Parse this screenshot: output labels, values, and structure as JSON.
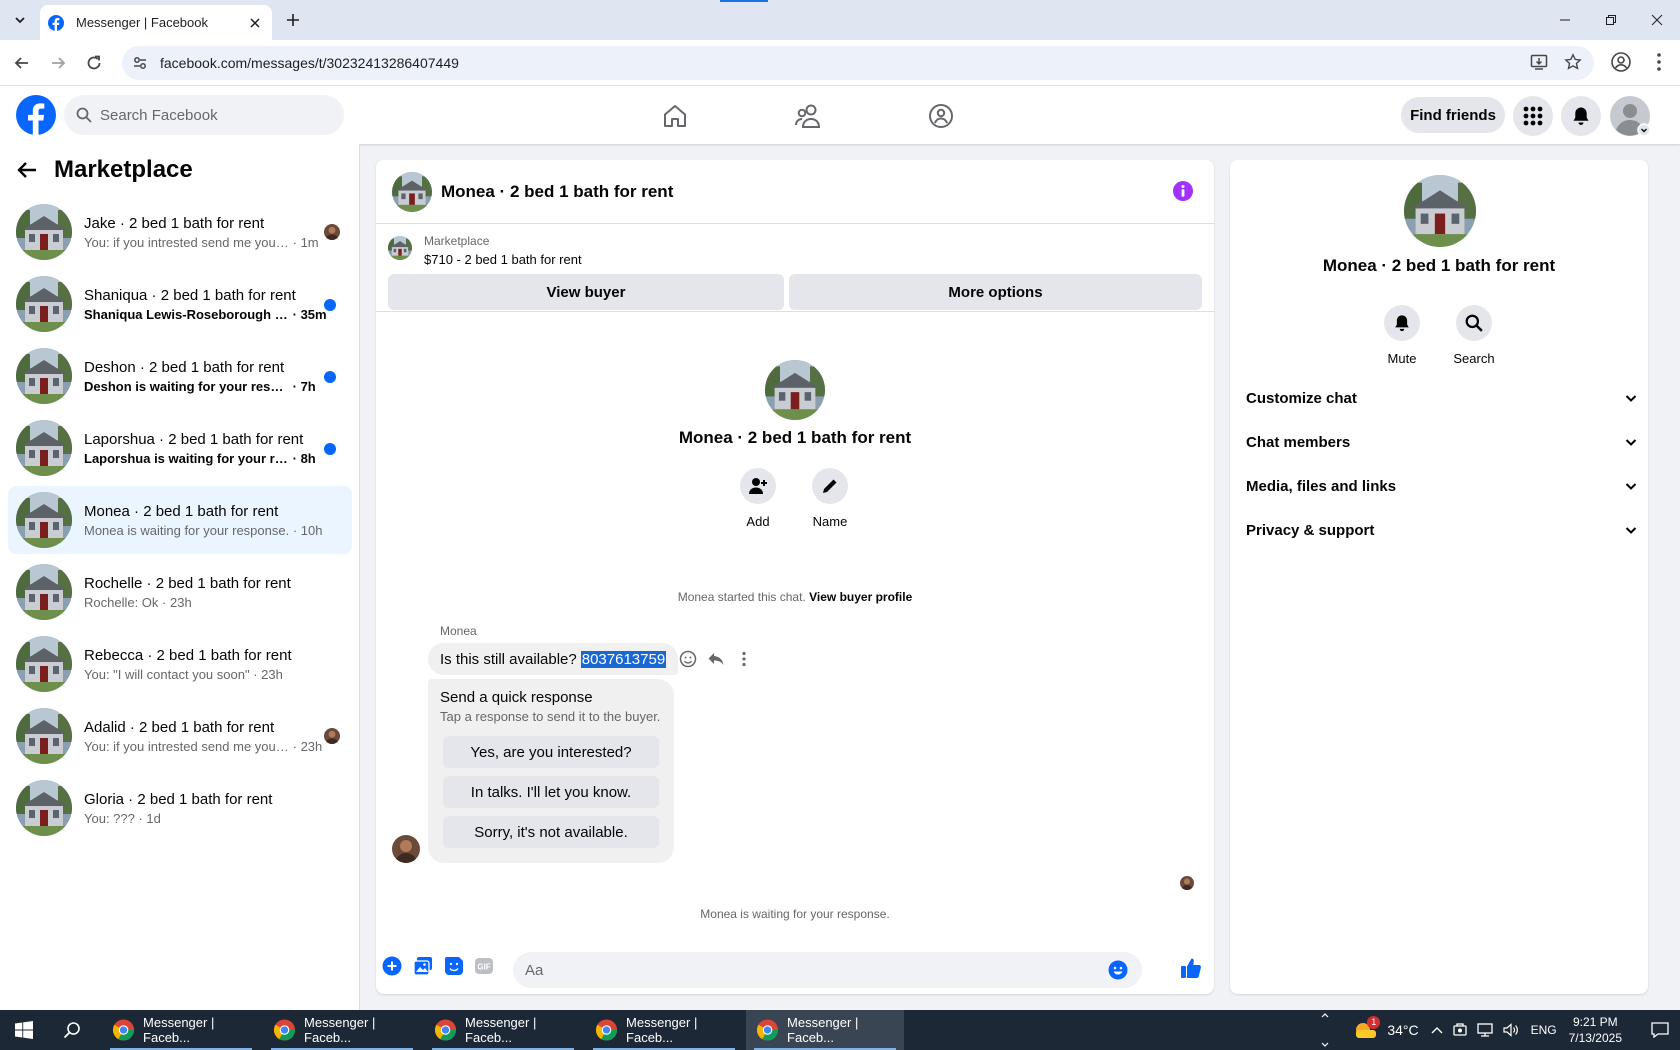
{
  "browser": {
    "tab_title": "Messenger | Facebook",
    "url": "facebook.com/messages/t/30232413286407449"
  },
  "header": {
    "search_placeholder": "Search Facebook",
    "find_friends_label": "Find friends"
  },
  "sidebar": {
    "title": "Marketplace",
    "conversations": [
      {
        "name": "Jake · 2 bed 1 bath for rent",
        "preview": "You: if you intrested send me your...",
        "time": "1m",
        "unread": false
      },
      {
        "name": "Shaniqua · 2 bed 1 bath for rent",
        "preview": "Shaniqua Lewis-Roseborough se...",
        "time": "35m",
        "unread": true
      },
      {
        "name": "Deshon · 2 bed 1 bath for rent",
        "preview": "Deshon is waiting for your respon...",
        "time": "7h",
        "unread": true
      },
      {
        "name": "Laporshua · 2 bed 1 bath for rent",
        "preview": "Laporshua is waiting for your resp...",
        "time": "8h",
        "unread": true
      },
      {
        "name": "Monea · 2 bed 1 bath for rent",
        "preview": "Monea is waiting for your response.",
        "time": "10h",
        "unread": false,
        "active": true
      },
      {
        "name": "Rochelle · 2 bed 1 bath for rent",
        "preview": "Rochelle: Ok",
        "time": "23h",
        "unread": false
      },
      {
        "name": "Rebecca · 2 bed 1 bath for rent",
        "preview": "You: \"I will contact you soon\"",
        "time": "23h",
        "unread": false
      },
      {
        "name": "Adalid · 2 bed 1 bath for rent",
        "preview": "You: if you intrested send me your...",
        "time": "23h",
        "unread": false
      },
      {
        "name": "Gloria · 2 bed 1 bath for rent",
        "preview": "You: ???",
        "time": "1d",
        "unread": false
      }
    ]
  },
  "chat": {
    "title": "Monea · 2 bed 1 bath for rent",
    "listing_source": "Marketplace",
    "listing_price": "$710 - 2 bed 1 bath for rent",
    "view_buyer_label": "View buyer",
    "more_options_label": "More options",
    "profile_name": "Monea · 2 bed 1 bath for rent",
    "add_label": "Add",
    "name_label": "Name",
    "started_text": "Monea started this chat.",
    "view_profile_link": "View buyer profile",
    "sender": "Monea",
    "message_text": "Is this still available?",
    "message_phone": "8037613759",
    "quick_title": "Send a quick response",
    "quick_sub": "Tap a response to send it to the buyer.",
    "quick_responses": [
      "Yes, are you interested?",
      "In talks. I'll let you know.",
      "Sorry, it's not available."
    ],
    "waiting_text": "Monea is waiting for your response.",
    "composer_placeholder": "Aa"
  },
  "details": {
    "name": "Monea · 2 bed 1 bath for rent",
    "mute_label": "Mute",
    "search_label": "Search",
    "sections": [
      "Customize chat",
      "Chat members",
      "Media, files and links",
      "Privacy & support"
    ]
  },
  "taskbar": {
    "apps": [
      "Messenger | Faceb...",
      "Messenger | Faceb...",
      "Messenger | Faceb...",
      "Messenger | Faceb...",
      "Messenger | Faceb..."
    ],
    "weather_badge": "1",
    "temperature": "34°C",
    "language": "ENG",
    "time": "9:21 PM",
    "date": "7/13/2025"
  },
  "colors": {
    "fb_blue": "#0866ff",
    "active_conv_bg": "#ebf5ff",
    "info_purple": "#a033ff",
    "selection_blue": "#1967d2"
  }
}
